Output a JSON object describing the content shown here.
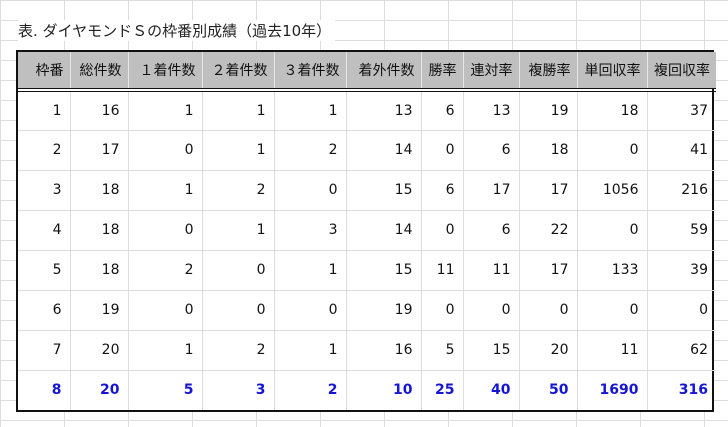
{
  "title": "表. ダイヤモンドＳの枠番別成績（過去10年）",
  "headers": [
    "枠番",
    "総件数",
    "１着件数",
    "２着件数",
    "３着件数",
    "着外件数",
    "勝率",
    "連対率",
    "複勝率",
    "単回収率",
    "複回収率"
  ],
  "rows": [
    [
      "1",
      "16",
      "1",
      "1",
      "1",
      "13",
      "6",
      "13",
      "19",
      "18",
      "37"
    ],
    [
      "2",
      "17",
      "0",
      "1",
      "2",
      "14",
      "0",
      "6",
      "18",
      "0",
      "41"
    ],
    [
      "3",
      "18",
      "1",
      "2",
      "0",
      "15",
      "6",
      "17",
      "17",
      "1056",
      "216"
    ],
    [
      "4",
      "18",
      "0",
      "1",
      "3",
      "14",
      "0",
      "6",
      "22",
      "0",
      "59"
    ],
    [
      "5",
      "18",
      "2",
      "0",
      "1",
      "15",
      "11",
      "11",
      "17",
      "133",
      "39"
    ],
    [
      "6",
      "19",
      "0",
      "0",
      "0",
      "19",
      "0",
      "0",
      "0",
      "0",
      "0"
    ],
    [
      "7",
      "20",
      "1",
      "2",
      "1",
      "16",
      "5",
      "15",
      "20",
      "11",
      "62"
    ],
    [
      "8",
      "20",
      "5",
      "3",
      "2",
      "10",
      "25",
      "40",
      "50",
      "1690",
      "316"
    ]
  ],
  "highlight_row_index": 7,
  "colors": {
    "header_bg": "#bfbfbf",
    "highlight_text": "#1515d6"
  }
}
